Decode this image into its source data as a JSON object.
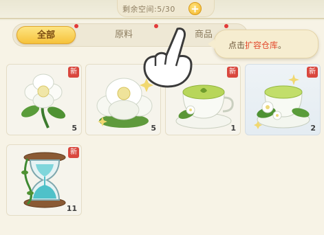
{
  "storage": {
    "label": "剩余空间:5/30",
    "add_icon": "plus-icon"
  },
  "tabs": [
    {
      "label": "全部",
      "active": true
    },
    {
      "label": "原料",
      "active": false
    },
    {
      "label": "商品",
      "active": false
    }
  ],
  "tooltip": {
    "prefix": "点击",
    "highlight": "扩容仓库",
    "suffix": "。"
  },
  "items": [
    {
      "name": "white-camellia-flower",
      "badge": "新",
      "count": "5"
    },
    {
      "name": "white-camellia-cluster",
      "badge": "新",
      "count": "5"
    },
    {
      "name": "green-tea-cup",
      "badge": "新",
      "count": "1"
    },
    {
      "name": "jasmine-green-tea",
      "badge": "新",
      "count": "2"
    },
    {
      "name": "vine-hourglass",
      "badge": "新",
      "count": "11"
    }
  ],
  "colors": {
    "badge_red": "#d9473e",
    "tab_active": "#f6c23b",
    "tooltip_highlight": "#e2492c"
  }
}
